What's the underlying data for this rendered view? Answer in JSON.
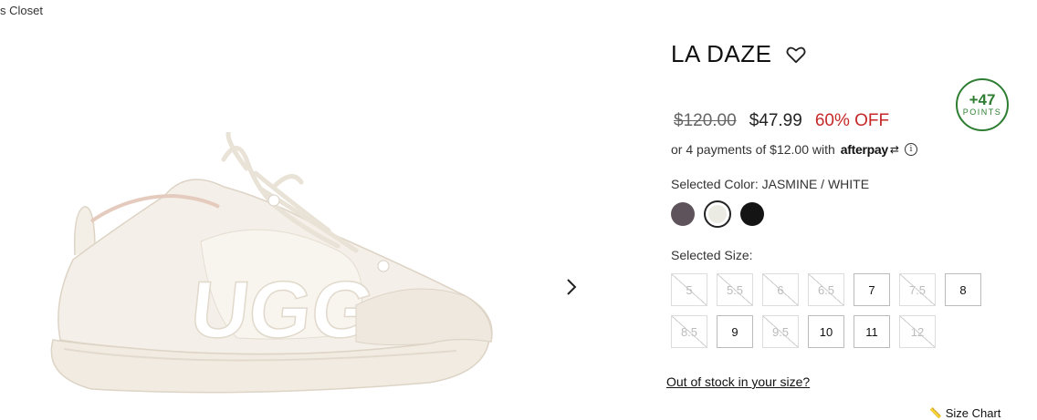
{
  "breadcrumb": {
    "text": "s Closet"
  },
  "product": {
    "title": "LA DAZE",
    "heart_icon": "heart-outline-icon",
    "points": {
      "value": "+47",
      "label": "POINTS"
    },
    "price_original": "$120.00",
    "price_sale": "$47.99",
    "discount": "60% OFF",
    "afterpay": {
      "text": "or 4 payments of $12.00 with",
      "brand": "afterpay"
    },
    "selected_color_label": "Selected Color: JASMINE / WHITE",
    "colors": [
      {
        "name": "dark-gray",
        "hex": "#5e535b"
      },
      {
        "name": "jasmine-white",
        "hex": "#ecebe3"
      },
      {
        "name": "black",
        "hex": "#141414"
      }
    ],
    "selected_size_label": "Selected Size:",
    "sizes": [
      {
        "label": "5",
        "available": false
      },
      {
        "label": "5.5",
        "available": false
      },
      {
        "label": "6",
        "available": false
      },
      {
        "label": "6.5",
        "available": false
      },
      {
        "label": "7",
        "available": true
      },
      {
        "label": "7.5",
        "available": false
      },
      {
        "label": "8",
        "available": true
      },
      {
        "label": "8.5",
        "available": false
      },
      {
        "label": "9",
        "available": true
      },
      {
        "label": "9.5",
        "available": false
      },
      {
        "label": "10",
        "available": true
      },
      {
        "label": "11",
        "available": true
      },
      {
        "label": "12",
        "available": false
      }
    ],
    "out_of_stock_link": "Out of stock in your size?",
    "size_chart_label": "Size Chart"
  },
  "colors": {
    "accent_green": "#2e7d32",
    "discount_red": "#c62828"
  }
}
